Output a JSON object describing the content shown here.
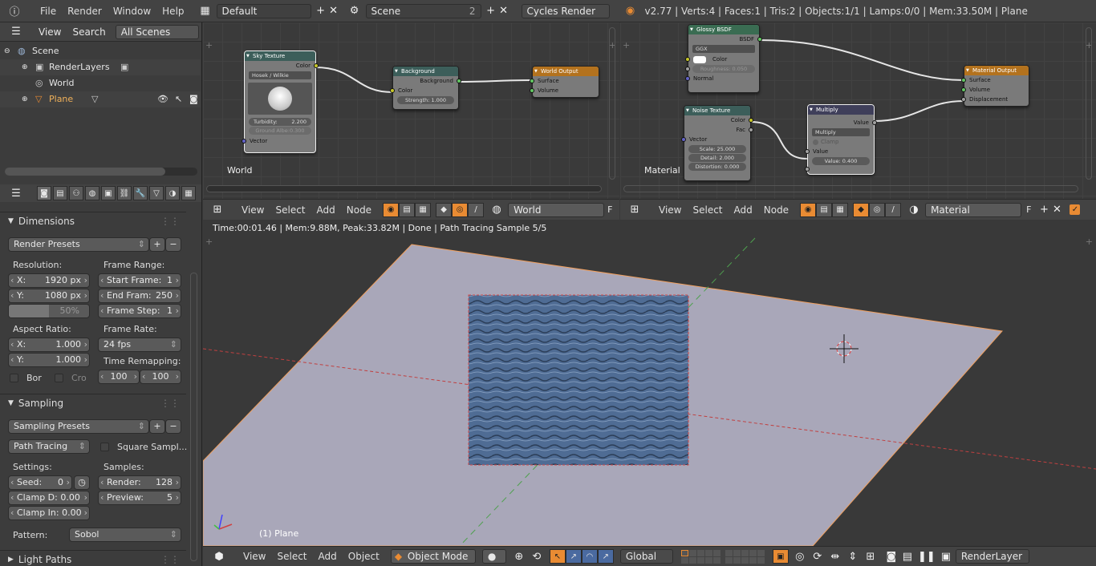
{
  "topbar": {
    "menus": [
      "File",
      "Render",
      "Window",
      "Help"
    ],
    "layout": "Default",
    "scene": "Scene",
    "scene_count": "2",
    "engine": "Cycles Render",
    "stats": "v2.77 | Verts:4 | Faces:1 | Tris:2 | Objects:1/1 | Lamps:0/0 | Mem:33.50M | Plane"
  },
  "outliner": {
    "menus": [
      "View",
      "Search"
    ],
    "filter": "All Scenes",
    "items": [
      {
        "label": "Scene"
      },
      {
        "label": "RenderLayers"
      },
      {
        "label": "World"
      },
      {
        "label": "Plane"
      }
    ]
  },
  "world_editor": {
    "label": "World",
    "menus": [
      "View",
      "Select",
      "Add",
      "Node"
    ],
    "datablock": "World",
    "fake_user": "F",
    "nodes": {
      "sky": {
        "title": "Sky Texture",
        "out": "Color",
        "model": "Hosek / Wilkie",
        "turbidity_k": "Turbidity:",
        "turbidity_v": "2.200",
        "ground": "Ground Albe:0.300",
        "in": "Vector"
      },
      "bg": {
        "title": "Background",
        "out": "Background",
        "in": "Color",
        "strength": "Strength:  1.000"
      },
      "out": {
        "title": "World Output",
        "surface": "Surface",
        "volume": "Volume"
      }
    }
  },
  "material_editor": {
    "label": "Material",
    "menus": [
      "View",
      "Select",
      "Add",
      "Node"
    ],
    "datablock": "Material",
    "fake_user": "F",
    "nodes": {
      "glossy": {
        "title": "Glossy BSDF",
        "out": "BSDF",
        "dist": "GGX",
        "color": "Color",
        "rough": "Roughness: 0.050",
        "normal": "Normal"
      },
      "noise": {
        "title": "Noise Texture",
        "color": "Color",
        "fac": "Fac",
        "vector": "Vector",
        "scale": "Scale:  25.000",
        "detail": "Detail:  2.000",
        "distortion": "Distortion:  0.000"
      },
      "mult": {
        "title": "Multiply",
        "out": "Value",
        "op": "Multiply",
        "clamp": "Clamp",
        "in": "Value",
        "value": "Value:  0.400"
      },
      "out": {
        "title": "Material Output",
        "surface": "Surface",
        "volume": "Volume",
        "disp": "Displacement"
      }
    }
  },
  "properties": {
    "dimensions": {
      "title": "Dimensions",
      "presets": "Render Presets",
      "resolution": "Resolution:",
      "res_x_k": "X:",
      "res_x_v": "1920 px",
      "res_y_k": "Y:",
      "res_y_v": "1080 px",
      "res_pct": "50%",
      "frame_range": "Frame Range:",
      "start_k": "Start Frame:",
      "start_v": "1",
      "end_k": "End Fram:",
      "end_v": "250",
      "step_k": "Frame Step:",
      "step_v": "1",
      "aspect": "Aspect Ratio:",
      "asp_x_k": "X:",
      "asp_x_v": "1.000",
      "asp_y_k": "Y:",
      "asp_y_v": "1.000",
      "frame_rate": "Frame Rate:",
      "fps": "24 fps",
      "border": "Bor",
      "crop": "Cro",
      "remap": "Time Remapping:",
      "remap_old": "100",
      "remap_new": "100"
    },
    "sampling": {
      "title": "Sampling",
      "presets": "Sampling Presets",
      "integrator": "Path Tracing",
      "square": "Square Sampl...",
      "settings": "Settings:",
      "samples": "Samples:",
      "seed_k": "Seed:",
      "seed_v": "0",
      "render_k": "Render:",
      "render_v": "128",
      "preview_k": "Preview:",
      "preview_v": "5",
      "clampd": "Clamp D: 0.00",
      "clampi": "Clamp In: 0.00",
      "pattern": "Pattern:",
      "pattern_v": "Sobol"
    },
    "light_paths": "Light Paths"
  },
  "viewport": {
    "status": "Time:00:01.46 | Mem:9.88M, Peak:33.82M | Done | Path Tracing Sample 5/5",
    "object_label": "(1) Plane",
    "menus": [
      "View",
      "Select",
      "Add",
      "Object"
    ],
    "mode": "Object Mode",
    "orientation": "Global",
    "render_layer": "RenderLayer"
  },
  "colors": {
    "accent": "#e98b33",
    "plane": "#a9a7b9",
    "water": "#4f6c94"
  }
}
